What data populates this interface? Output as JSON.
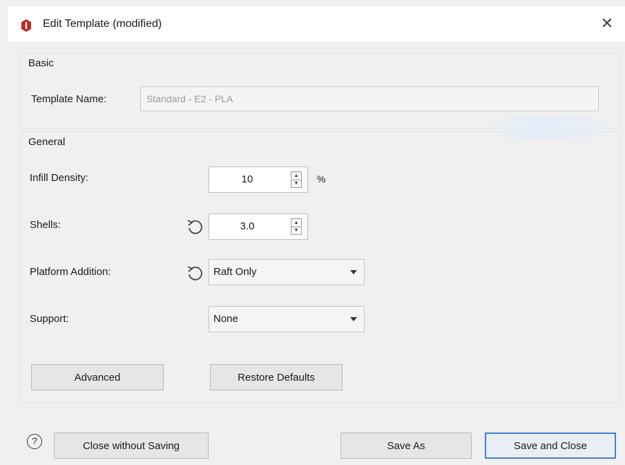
{
  "window": {
    "title": "Edit Template (modified)",
    "close_glyph": "✕",
    "icon": "app-logo-icon",
    "accent_color": "#c0271f"
  },
  "basic": {
    "group_title": "Basic",
    "template_name_label": "Template Name:",
    "template_name_value": "Standard - E2 - PLA"
  },
  "general": {
    "group_title": "General",
    "infill_density": {
      "label": "Infill Density:",
      "value": "10",
      "unit": "%"
    },
    "shells": {
      "label": "Shells:",
      "value": "3.0"
    },
    "platform_addition": {
      "label": "Platform Addition:",
      "value": "Raft Only"
    },
    "support": {
      "label": "Support:",
      "value": "None"
    },
    "advanced_button": "Advanced",
    "restore_defaults_button": "Restore Defaults"
  },
  "footer": {
    "help_glyph": "?",
    "close_without_saving": "Close without Saving",
    "save_as": "Save As",
    "save_and_close": "Save and Close",
    "primary_border_color": "#3c7fd6"
  }
}
